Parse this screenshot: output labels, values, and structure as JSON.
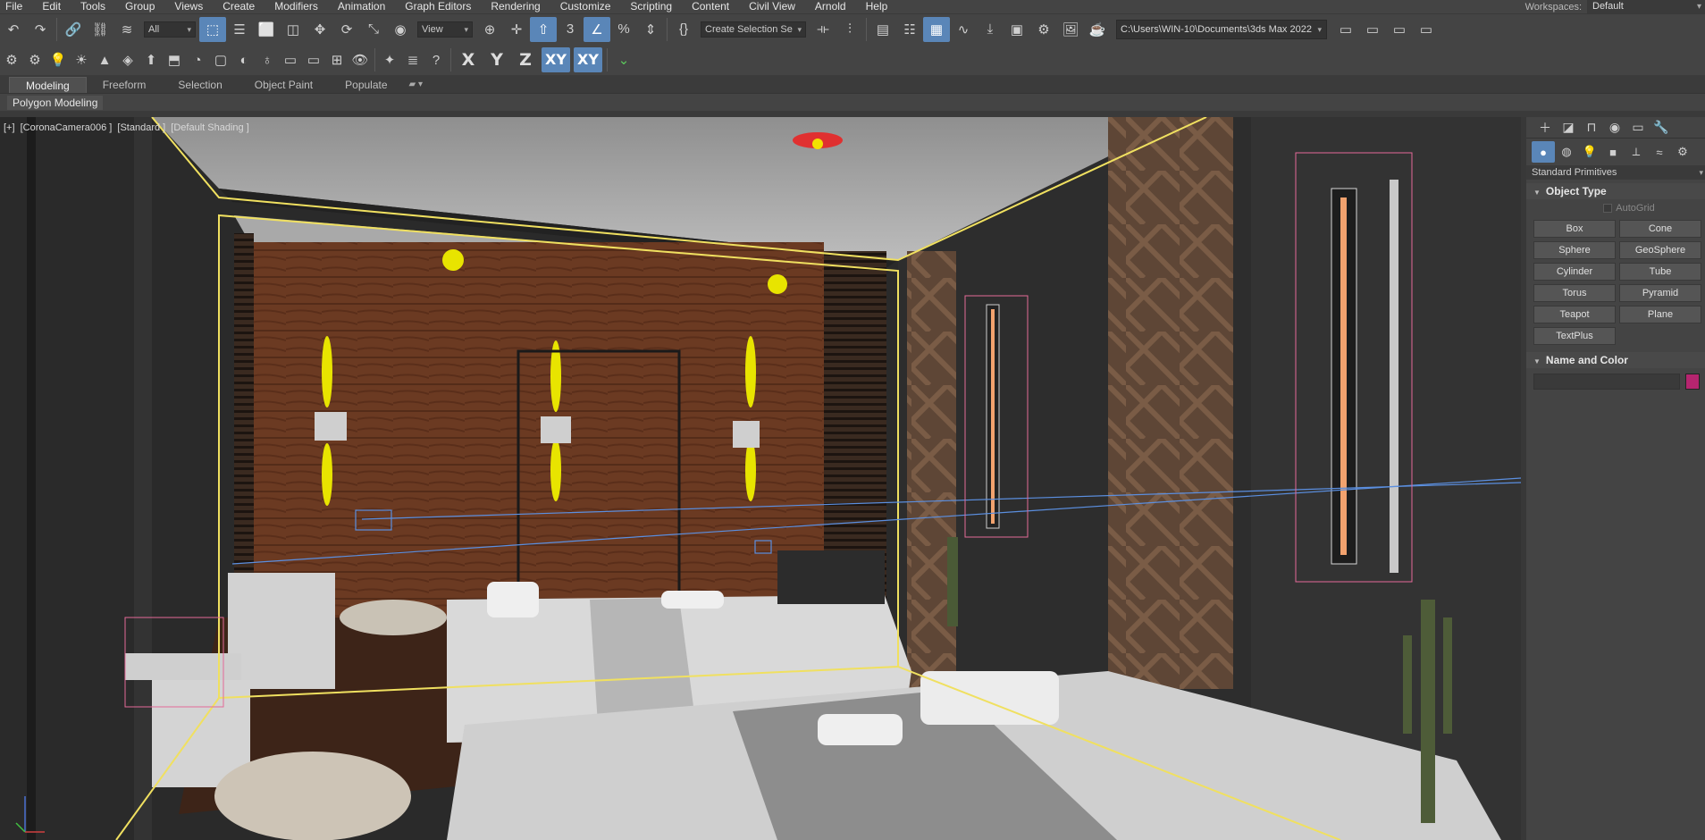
{
  "menu": [
    "File",
    "Edit",
    "Tools",
    "Group",
    "Views",
    "Create",
    "Modifiers",
    "Animation",
    "Graph Editors",
    "Rendering",
    "Customize",
    "Scripting",
    "Content",
    "Civil View",
    "Arnold",
    "Help"
  ],
  "workspace": {
    "label": "Workspaces:",
    "value": "Default"
  },
  "toolbar1": {
    "selection_filter": "All",
    "ref_coord": "View",
    "named_selection": "Create Selection Se",
    "project_path": "C:\\Users\\WIN-10\\Documents\\3ds Max 2022"
  },
  "toolbar2": {
    "axes": [
      "X",
      "Y",
      "Z",
      "XY",
      "XY"
    ]
  },
  "ribbon": {
    "tabs": [
      "Modeling",
      "Freeform",
      "Selection",
      "Object Paint",
      "Populate"
    ],
    "active": "Modeling",
    "sub_label": "Polygon Modeling"
  },
  "viewport": {
    "label_parts": [
      "[+]",
      "[CoronaCamera006 ]",
      "[Standard ]",
      "[Default Shading ]"
    ]
  },
  "command_panel": {
    "primitive_type": "Standard Primitives",
    "object_type_title": "Object Type",
    "autogrid": "AutoGrid",
    "buttons": [
      "Box",
      "Cone",
      "Sphere",
      "GeoSphere",
      "Cylinder",
      "Tube",
      "Torus",
      "Pyramid",
      "Teapot",
      "Plane",
      "TextPlus"
    ],
    "name_color_title": "Name and Color",
    "color_swatch": "#b5256f"
  },
  "colors": {
    "accent": "#5a86b8",
    "selection_yellow": "#f0e060"
  }
}
